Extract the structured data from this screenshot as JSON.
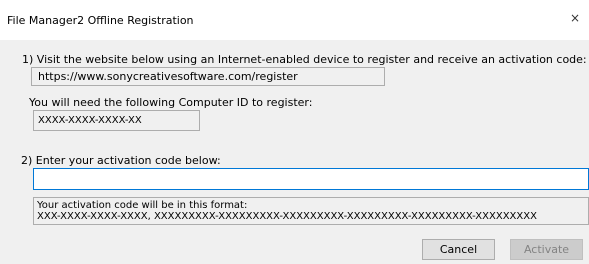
{
  "window": {
    "title": "File Manager2 Offline Registration",
    "close_glyph": "×"
  },
  "step1": {
    "instruction": "1) Visit the website below using an Internet-enabled device to register and receive an activation code:",
    "url": "https://www.sonycreativesoftware.com/register"
  },
  "computer_id": {
    "label": "You will need the following Computer ID to register:",
    "value": "XXXX-XXXX-XXXX-XX"
  },
  "step2": {
    "instruction": "2) Enter your activation code below:",
    "code_value": ""
  },
  "format": {
    "heading": "Your activation code will be in this format:",
    "example": "XXX-XXXX-XXXX-XXXX, XXXXXXXXX-XXXXXXXXX-XXXXXXXXX-XXXXXXXXX-XXXXXXXXX-XXXXXXXXX"
  },
  "buttons": {
    "cancel": "Cancel",
    "activate": "Activate",
    "activate_enabled": false
  },
  "icons": {
    "close": "close-icon"
  },
  "colors": {
    "focus_border": "#0078d7",
    "dialog_background": "#f0f0f0",
    "disabled_text": "#838383"
  }
}
